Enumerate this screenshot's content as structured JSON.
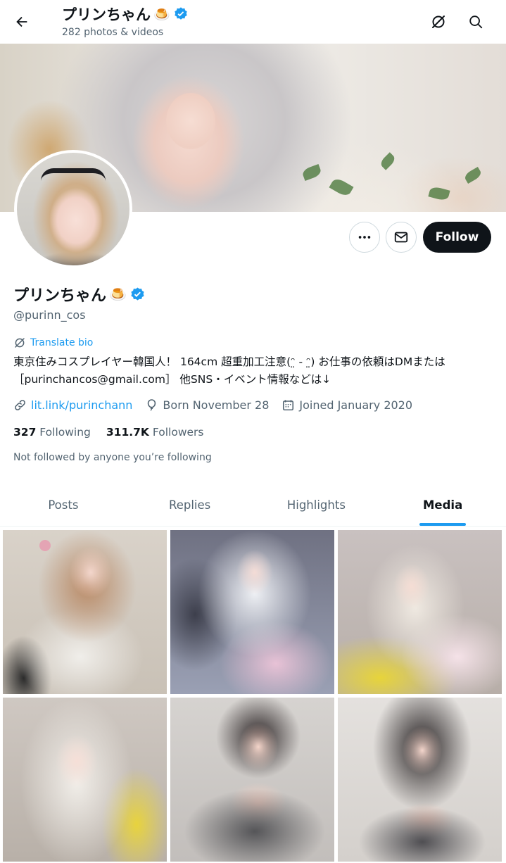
{
  "header": {
    "display_name": "プリンちゃん",
    "emoji": "🍮",
    "post_count": "282 photos & videos"
  },
  "profile": {
    "display_name": "プリンちゃん",
    "emoji": "🍮",
    "handle": "@purinn_cos",
    "translate_label": "Translate bio",
    "bio": "東京住みコスプレイヤー韓国人！ 164cm 超重加工注意(ᵔ̤ - ᵔ̤) お仕事の依頼はDMまたは ［purinchancos@gmail.com］ 他SNS・イベント情報などは↓",
    "link": "lit.link/purinchann",
    "born": "Born November 28",
    "joined": "Joined January 2020",
    "following_count": "327",
    "following_label": "Following",
    "followers_count": "311.7K",
    "followers_label": "Followers",
    "not_followed": "Not followed by anyone you’re following"
  },
  "actions": {
    "follow_label": "Follow"
  },
  "tabs": [
    {
      "label": "Posts"
    },
    {
      "label": "Replies"
    },
    {
      "label": "Highlights"
    },
    {
      "label": "Media"
    }
  ],
  "active_tab": "Media",
  "colors": {
    "accent": "#1d9bf0",
    "text_primary": "#0f1419",
    "text_secondary": "#536471",
    "follow_button_bg": "#0f1419"
  },
  "icons": {
    "back": "arrow-left-icon",
    "translate_toggle": "translate-icon",
    "search": "search-icon",
    "more": "more-icon",
    "message": "mail-icon",
    "verified": "verified-badge-icon",
    "link": "link-icon",
    "born": "balloon-icon",
    "joined": "calendar-icon"
  },
  "media_tiles": [
    {
      "name": "media-thumbnail-1"
    },
    {
      "name": "media-thumbnail-2"
    },
    {
      "name": "media-thumbnail-3"
    },
    {
      "name": "media-thumbnail-4"
    },
    {
      "name": "media-thumbnail-5"
    },
    {
      "name": "media-thumbnail-6"
    }
  ]
}
